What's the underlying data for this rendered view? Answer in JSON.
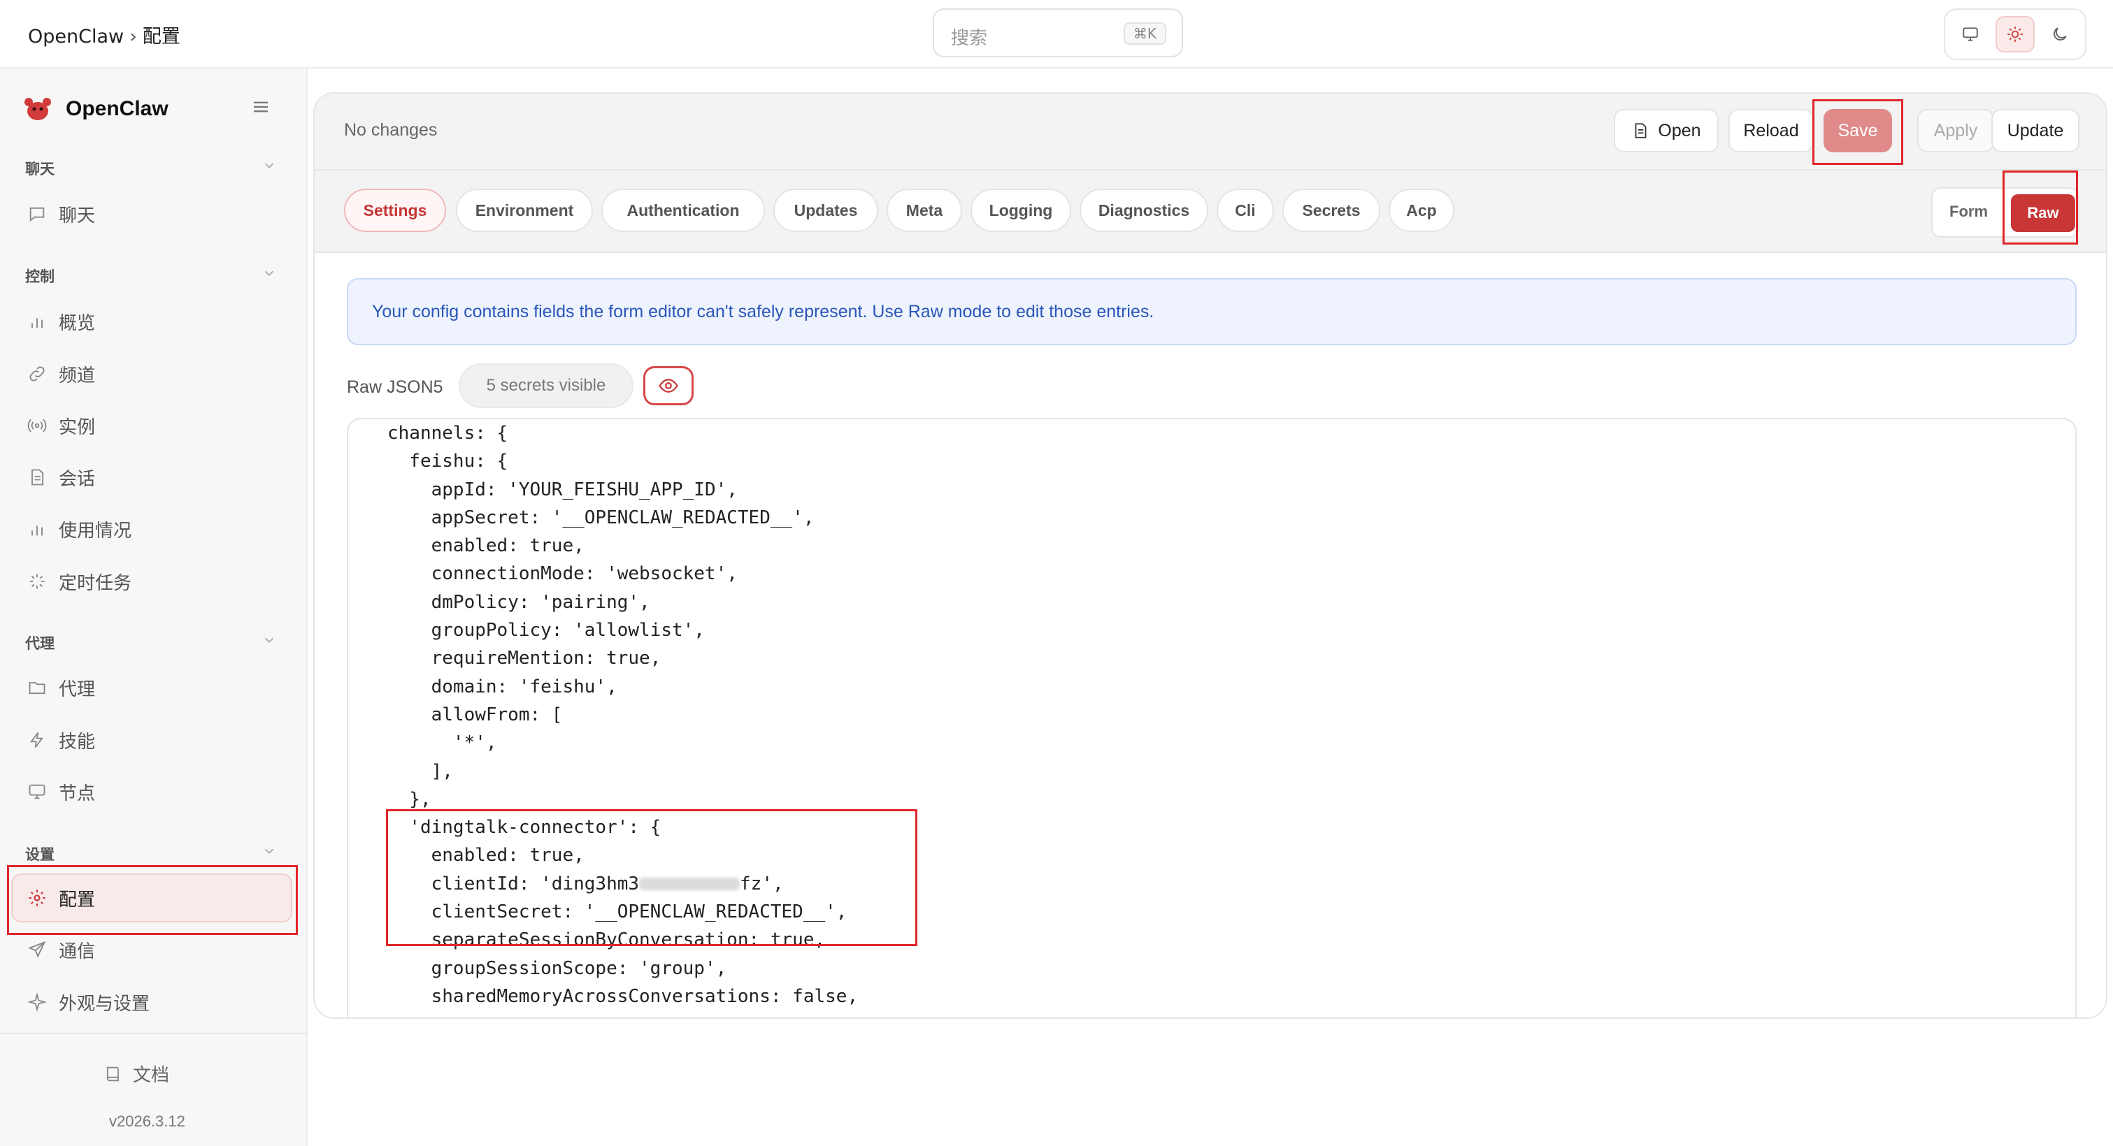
{
  "header": {
    "breadcrumb_root": "OpenClaw",
    "breadcrumb_sep": "›",
    "breadcrumb_current": "配置",
    "search_placeholder": "搜索",
    "search_shortcut": "⌘K"
  },
  "sidebar": {
    "brand": "OpenClaw",
    "groups": [
      {
        "title": "聊天",
        "items": [
          "聊天"
        ]
      },
      {
        "title": "控制",
        "items": [
          "概览",
          "频道",
          "实例",
          "会话",
          "使用情况",
          "定时任务"
        ]
      },
      {
        "title": "代理",
        "items": [
          "代理",
          "技能",
          "节点"
        ]
      },
      {
        "title": "设置",
        "items": [
          "配置",
          "通信",
          "外观与设置"
        ]
      }
    ],
    "active_item": "配置",
    "docs": "文档",
    "version": "v2026.3.12"
  },
  "toolbar": {
    "status": "No changes",
    "open": "Open",
    "reload": "Reload",
    "save": "Save",
    "apply": "Apply",
    "update": "Update"
  },
  "tabs": [
    "Settings",
    "Environment",
    "Authentication",
    "Updates",
    "Meta",
    "Logging",
    "Diagnostics",
    "Cli",
    "Secrets",
    "Acp"
  ],
  "active_tab": "Settings",
  "mode": {
    "form": "Form",
    "raw": "Raw",
    "active": "Raw"
  },
  "banner": "Your config contains fields the form editor can't safely represent. Use Raw mode to edit those entries.",
  "raw": {
    "label": "Raw JSON5",
    "secrets": "5 secrets visible"
  },
  "code_lines": [
    "channels: {",
    "  feishu: {",
    "    appId: 'YOUR_FEISHU_APP_ID',",
    "    appSecret: '__OPENCLAW_REDACTED__',",
    "    enabled: true,",
    "    connectionMode: 'websocket',",
    "    dmPolicy: 'pairing',",
    "    groupPolicy: 'allowlist',",
    "    requireMention: true,",
    "    domain: 'feishu',",
    "    allowFrom: [",
    "      '*',",
    "    ],",
    "  },",
    "  'dingtalk-connector': {",
    "    enabled: true,",
    "    clientId: 'ding3hm3",
    "    clientSecret: '__OPENCLAW_REDACTED__',",
    "    separateSessionByConversation: true,",
    "    groupSessionScope: 'group',",
    "    sharedMemoryAcrossConversations: false,"
  ],
  "client_id_suffix": "fz',",
  "colors": {
    "accent": "#c93636",
    "save_disabled": "#e08a8a",
    "banner_text": "#2a56b8",
    "highlight": "#e0262a"
  }
}
